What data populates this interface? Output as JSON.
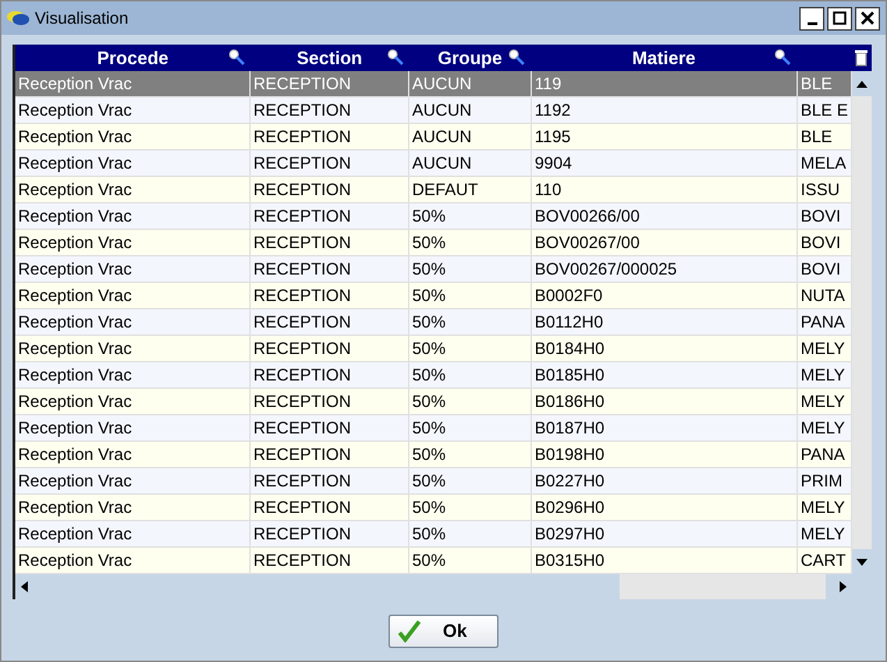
{
  "window": {
    "title": "Visualisation"
  },
  "table": {
    "columns": [
      "Procede",
      "Section",
      "Groupe",
      "Matiere"
    ],
    "rows": [
      {
        "procede": "Reception Vrac",
        "section": "RECEPTION",
        "groupe": "AUCUN",
        "matiere": "119",
        "column_5": "BLE",
        "selected": true
      },
      {
        "procede": "Reception Vrac",
        "section": "RECEPTION",
        "groupe": "AUCUN",
        "matiere": "1192",
        "column_5": "BLE E",
        "selected": false
      },
      {
        "procede": "Reception Vrac",
        "section": "RECEPTION",
        "groupe": "AUCUN",
        "matiere": "1195",
        "column_5": "BLE",
        "selected": false
      },
      {
        "procede": "Reception Vrac",
        "section": "RECEPTION",
        "groupe": "AUCUN",
        "matiere": "9904",
        "column_5": "MELA",
        "selected": false
      },
      {
        "procede": "Reception Vrac",
        "section": "RECEPTION",
        "groupe": "DEFAUT",
        "matiere": "110",
        "column_5": "ISSU",
        "selected": false
      },
      {
        "procede": "Reception Vrac",
        "section": "RECEPTION",
        "groupe": "50%",
        "matiere": "BOV00266/00",
        "column_5": "BOVI",
        "selected": false
      },
      {
        "procede": "Reception Vrac",
        "section": "RECEPTION",
        "groupe": "50%",
        "matiere": "BOV00267/00",
        "column_5": "BOVI",
        "selected": false
      },
      {
        "procede": "Reception Vrac",
        "section": "RECEPTION",
        "groupe": "50%",
        "matiere": "BOV00267/000025",
        "column_5": "BOVI",
        "selected": false
      },
      {
        "procede": "Reception Vrac",
        "section": "RECEPTION",
        "groupe": "50%",
        "matiere": "B0002F0",
        "column_5": "NUTA",
        "selected": false
      },
      {
        "procede": "Reception Vrac",
        "section": "RECEPTION",
        "groupe": "50%",
        "matiere": "B0112H0",
        "column_5": "PANA",
        "selected": false
      },
      {
        "procede": "Reception Vrac",
        "section": "RECEPTION",
        "groupe": "50%",
        "matiere": "B0184H0",
        "column_5": "MELY",
        "selected": false
      },
      {
        "procede": "Reception Vrac",
        "section": "RECEPTION",
        "groupe": "50%",
        "matiere": "B0185H0",
        "column_5": "MELY",
        "selected": false
      },
      {
        "procede": "Reception Vrac",
        "section": "RECEPTION",
        "groupe": "50%",
        "matiere": "B0186H0",
        "column_5": "MELY",
        "selected": false
      },
      {
        "procede": "Reception Vrac",
        "section": "RECEPTION",
        "groupe": "50%",
        "matiere": "B0187H0",
        "column_5": "MELY",
        "selected": false
      },
      {
        "procede": "Reception Vrac",
        "section": "RECEPTION",
        "groupe": "50%",
        "matiere": "B0198H0",
        "column_5": "PANA",
        "selected": false
      },
      {
        "procede": "Reception Vrac",
        "section": "RECEPTION",
        "groupe": "50%",
        "matiere": "B0227H0",
        "column_5": "PRIM",
        "selected": false
      },
      {
        "procede": "Reception Vrac",
        "section": "RECEPTION",
        "groupe": "50%",
        "matiere": "B0296H0",
        "column_5": "MELY",
        "selected": false
      },
      {
        "procede": "Reception Vrac",
        "section": "RECEPTION",
        "groupe": "50%",
        "matiere": "B0297H0",
        "column_5": "MELY",
        "selected": false
      },
      {
        "procede": "Reception Vrac",
        "section": "RECEPTION",
        "groupe": "50%",
        "matiere": "B0315H0",
        "column_5": "CART",
        "selected": false
      }
    ]
  },
  "buttons": [
    {
      "label": "Ok"
    }
  ]
}
